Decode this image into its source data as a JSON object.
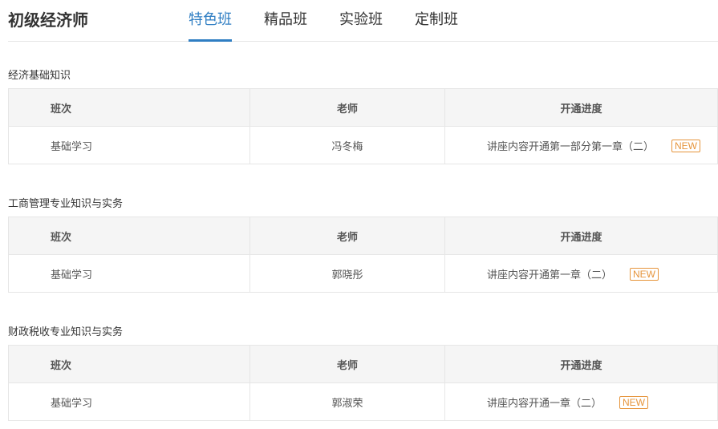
{
  "header": {
    "title": "初级经济师",
    "tabs": [
      {
        "label": "特色班",
        "active": true
      },
      {
        "label": "精品班"
      },
      {
        "label": "实验班"
      },
      {
        "label": "定制班"
      }
    ]
  },
  "table_headers": {
    "class": "班次",
    "teacher": "老师",
    "progress": "开通进度"
  },
  "sections": [
    {
      "title": "经济基础知识",
      "row": {
        "class": "基础学习",
        "teacher": "冯冬梅",
        "progress": "讲座内容开通第一部分第一章（二）",
        "badge": "NEW"
      }
    },
    {
      "title": "工商管理专业知识与实务",
      "row": {
        "class": "基础学习",
        "teacher": "郭晓彤",
        "progress": "讲座内容开通第一章（二）",
        "badge": "NEW"
      }
    },
    {
      "title": "财政税收专业知识与实务",
      "row": {
        "class": "基础学习",
        "teacher": "郭淑荣",
        "progress": "讲座内容开通一章（二）",
        "badge": "NEW"
      }
    }
  ],
  "colors": {
    "accent": "#2f7ec3",
    "badge": "#e6953c"
  }
}
